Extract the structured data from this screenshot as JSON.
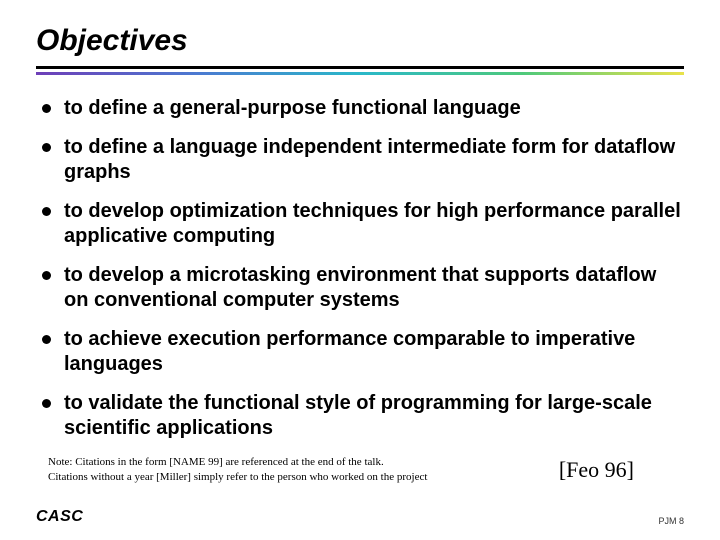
{
  "title": "Objectives",
  "bullets": {
    "b0": "to define a general-purpose functional language",
    "b1": "to define a language independent intermediate form for dataflow graphs",
    "b2": "to develop optimization techniques for high performance parallel applicative computing",
    "b3": "to develop a microtasking environment that supports dataflow on conventional computer systems",
    "b4": "to achieve execution performance comparable to imperative languages",
    "b5": "to validate the functional style of programming for large-scale scientific applications"
  },
  "note": {
    "line1": "Note:   Citations in the form [NAME 99] are referenced at the end of the talk.",
    "line2": "Citations without a year [Miller] simply refer to the person who worked on the project"
  },
  "citation": "[Feo 96]",
  "footer": {
    "left": "CASC",
    "right": "PJM  8"
  }
}
